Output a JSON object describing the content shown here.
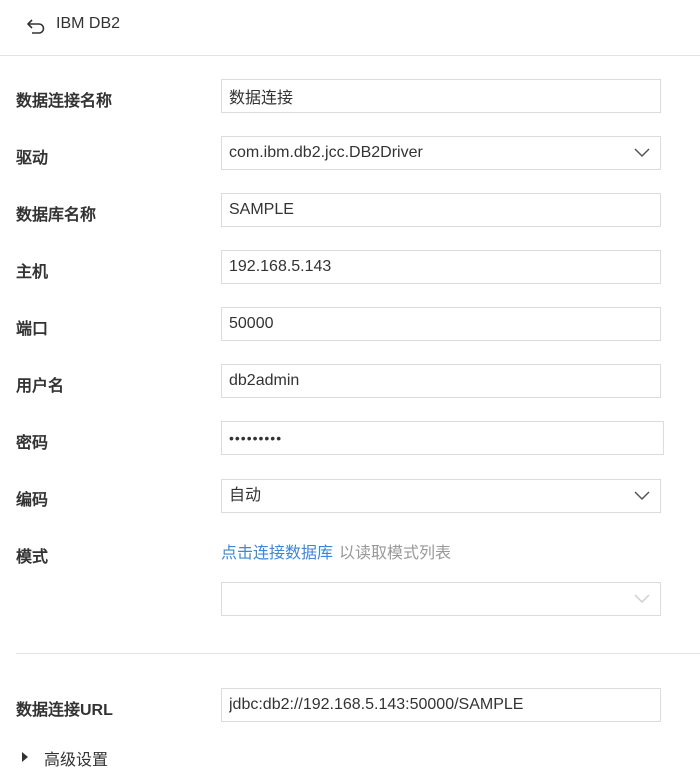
{
  "header": {
    "title": "IBM DB2"
  },
  "form": {
    "connection_name": {
      "label": "数据连接名称",
      "value": "数据连接"
    },
    "driver": {
      "label": "驱动",
      "value": "com.ibm.db2.jcc.DB2Driver"
    },
    "database_name": {
      "label": "数据库名称",
      "value": "SAMPLE"
    },
    "host": {
      "label": "主机",
      "value": "192.168.5.143"
    },
    "port": {
      "label": "端口",
      "value": "50000"
    },
    "username": {
      "label": "用户名",
      "value": "db2admin"
    },
    "password": {
      "label": "密码",
      "value": "•••••••••"
    },
    "encoding": {
      "label": "编码",
      "value": "自动"
    },
    "schema": {
      "label": "模式",
      "link": "点击连接数据库",
      "hint": "以读取模式列表",
      "value": ""
    },
    "url": {
      "label": "数据连接URL",
      "value": "jdbc:db2://192.168.5.143:50000/SAMPLE"
    }
  },
  "advanced": {
    "label": "高级设置"
  }
}
